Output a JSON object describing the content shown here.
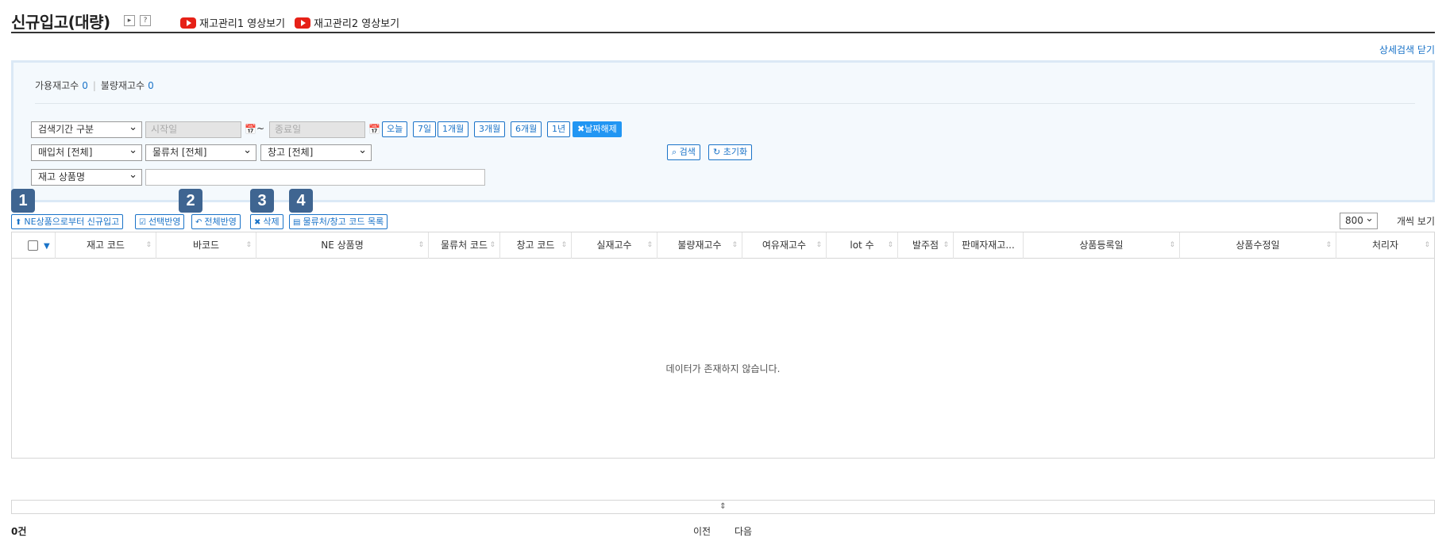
{
  "header": {
    "title": "신규입고(대량)",
    "play_btn": "▸",
    "help_btn": "?",
    "video_links": [
      "재고관리1 영상보기",
      "재고관리2 영상보기"
    ]
  },
  "detail_search_toggle": "상세검색 닫기",
  "summary": {
    "available_label": "가용재고수",
    "available_value": "0",
    "defective_label": "불량재고수",
    "defective_value": "0"
  },
  "filters": {
    "period_select": "검색기간 구분",
    "start_placeholder": "시작일",
    "tilde": "~",
    "end_placeholder": "종료일",
    "quick_dates": [
      "오늘",
      "7일",
      "1개월",
      "3개월",
      "6개월",
      "1년"
    ],
    "clear_dates": "날짜해제",
    "supplier_select": "매입처 [전체]",
    "logistics_select": "물류처 [전체]",
    "warehouse_select": "창고 [전체]",
    "product_select": "재고 상품명",
    "search_btn": "검색",
    "reset_btn": "초기화"
  },
  "actions": {
    "badges": [
      "1",
      "2",
      "3",
      "4"
    ],
    "new_from_ne": "NE상품으로부터 신규입고",
    "apply_selected": "선택반영",
    "apply_all": "전체반영",
    "delete": "삭제",
    "code_list": "물류처/창고 코드 목록"
  },
  "pagination": {
    "page_size": "800",
    "page_size_label": "개씩 보기",
    "total": "0건",
    "prev": "이전",
    "next": "다음"
  },
  "grid": {
    "columns": [
      "재고 코드",
      "바코드",
      "NE 상품명",
      "물류처 코드",
      "창고 코드",
      "실재고수",
      "불량재고수",
      "여유재고수",
      "lot 수",
      "발주점",
      "판매자재고...",
      "상품등록일",
      "상품수정일",
      "처리자"
    ],
    "empty_message": "데이터가 존재하지 않습니다.",
    "resizer_glyph": "⇕"
  },
  "colors": {
    "accent": "#1a73c8",
    "badge": "#3f6591",
    "panel_bg": "#f4f9fd",
    "youtube": "#e62117"
  }
}
